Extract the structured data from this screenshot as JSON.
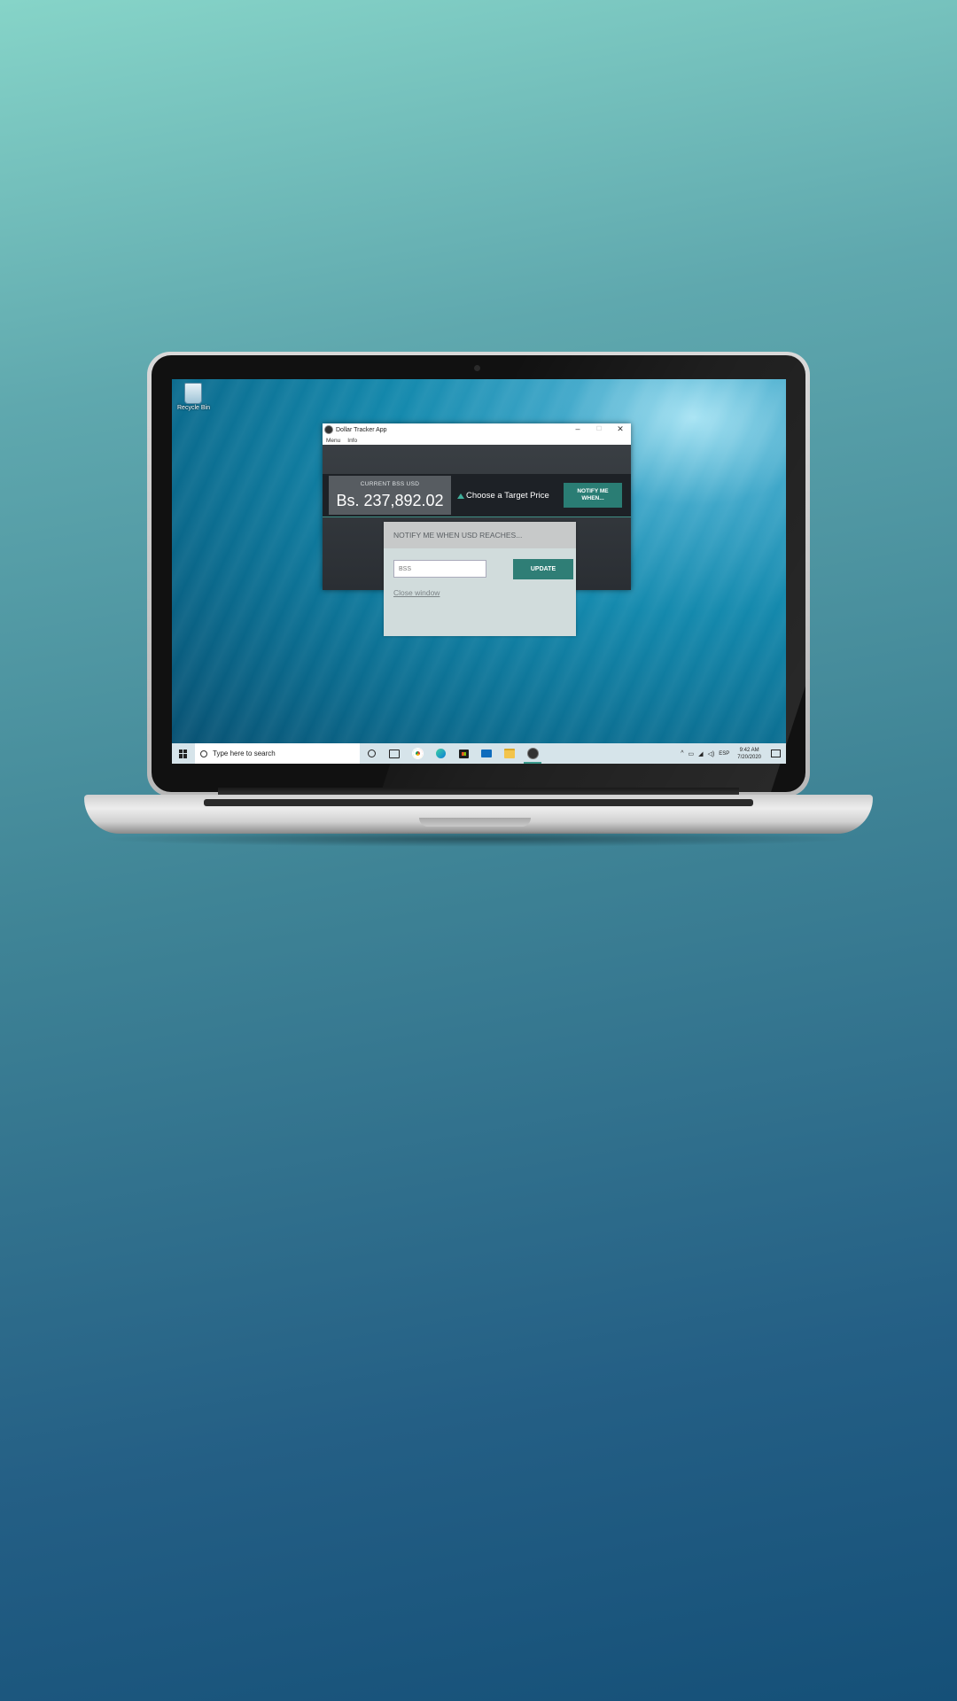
{
  "desktop": {
    "recycle_bin_label": "Recycle Bin"
  },
  "window": {
    "title": "Dollar Tracker App",
    "controls": {
      "minimize": "–",
      "maximize": "☐",
      "close": "✕"
    },
    "menu": [
      "Menu",
      "Info"
    ]
  },
  "app": {
    "price_caption": "CURRENT BSS USD",
    "price_value": "Bs. 237,892.02",
    "target_label": "Choose a Target Price",
    "notify_button": "NOTIFY ME\nWHEN..."
  },
  "popup": {
    "title": "NOTIFY ME WHEN USD REACHES...",
    "input_placeholder": "BSS",
    "update_button": "UPDATE",
    "close_link": "Close window"
  },
  "taskbar": {
    "search_placeholder": "Type here to search",
    "language": "ESP",
    "time": "9:42 AM",
    "date": "7/20/2020",
    "tray_icons": [
      "chevron-up-icon",
      "battery-icon",
      "wifi-icon",
      "volume-icon"
    ]
  },
  "colors": {
    "accent": "#2a7d74",
    "accent_line": "#3fae9a"
  }
}
